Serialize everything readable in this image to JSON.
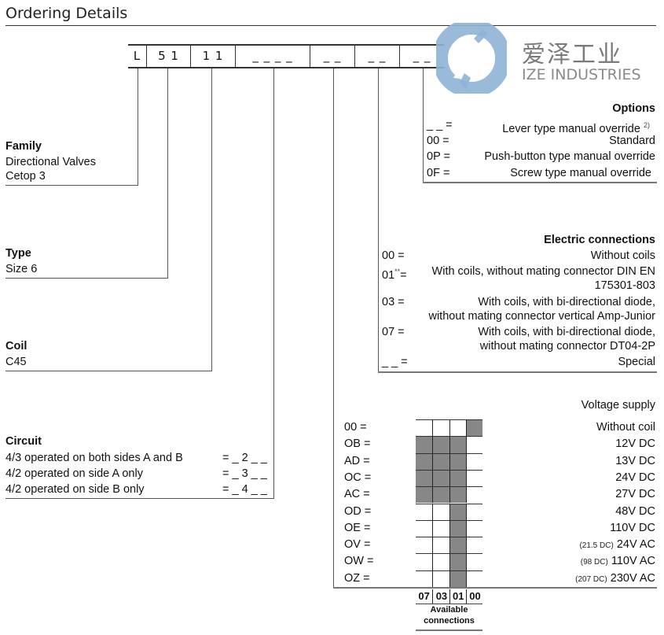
{
  "title": "Ordering Details",
  "code_boxes": [
    "L",
    "5 1",
    "1 1",
    "_ _ _ _",
    "_ _",
    "_ _",
    "_ _"
  ],
  "family": {
    "heading": "Family",
    "lines": [
      "Directional Valves",
      "Cetop 3"
    ]
  },
  "type": {
    "heading": "Type",
    "lines": [
      "Size 6"
    ]
  },
  "coil": {
    "heading": "Coil",
    "lines": [
      "C45"
    ]
  },
  "circuit": {
    "heading": "Circuit",
    "rows": [
      {
        "label": "4/3 operated on both sides A and B",
        "code": "= _ 2 _ _"
      },
      {
        "label": "4/2 operated on side A only",
        "code": "= _ 3 _ _"
      },
      {
        "label": "4/2 operated on side B only",
        "code": "= _ 4 _ _"
      }
    ]
  },
  "options": {
    "heading": "Options",
    "rows": [
      {
        "code": "_ _ =",
        "label": "Lever type manual override",
        "footnote": "2)"
      },
      {
        "code": "00 =",
        "label": "Standard"
      },
      {
        "code": "0P =",
        "label": "Push-button type manual override"
      },
      {
        "code": "0F =",
        "label": "Screw type manual override"
      }
    ]
  },
  "electric_connections": {
    "heading": "Electric connections",
    "rows": [
      {
        "code": "00  =",
        "lines": [
          "Without coils"
        ]
      },
      {
        "code": "01",
        "code_sup": "**",
        "code_suffix": "=",
        "lines": [
          "With coils, without mating connector DIN EN",
          "175301-803"
        ]
      },
      {
        "code": "03 =",
        "lines": [
          "With coils, with bi-directional diode,",
          "without mating connector vertical Amp-Junior"
        ]
      },
      {
        "code": "07 =",
        "lines": [
          "With coils, with bi-directional diode,",
          "without mating connector DT04-2P"
        ]
      },
      {
        "code": "_ _  =",
        "lines": [
          "Special"
        ]
      }
    ]
  },
  "voltage_supply": {
    "heading": "Voltage supply",
    "fill_color": "#878787",
    "columns": [
      "07",
      "03",
      "01",
      "00"
    ],
    "footer": [
      "Available",
      "connections"
    ],
    "rows": [
      {
        "code": "00 =",
        "note": "",
        "label": "Without coil",
        "available": [
          false,
          false,
          false,
          true
        ]
      },
      {
        "code": "OB =",
        "note": "",
        "label": "12V DC",
        "available": [
          true,
          true,
          true,
          false
        ]
      },
      {
        "code": "AD =",
        "note": "",
        "label": "13V DC",
        "available": [
          true,
          true,
          true,
          false
        ]
      },
      {
        "code": "OC =",
        "note": "",
        "label": "24V DC",
        "available": [
          true,
          true,
          true,
          false
        ]
      },
      {
        "code": "AC =",
        "note": "",
        "label": "27V DC",
        "available": [
          true,
          true,
          true,
          false
        ]
      },
      {
        "code": "OD =",
        "note": "",
        "label": "48V DC",
        "available": [
          false,
          false,
          true,
          false
        ]
      },
      {
        "code": "OE =",
        "note": "",
        "label": "110V DC",
        "available": [
          false,
          false,
          true,
          false
        ]
      },
      {
        "code": "OV =",
        "note": "(21.5 DC)",
        "label": "24V AC",
        "available": [
          false,
          false,
          true,
          false
        ]
      },
      {
        "code": "OW =",
        "note": "(98 DC)",
        "label": "110V AC",
        "available": [
          false,
          false,
          true,
          false
        ]
      },
      {
        "code": "OZ =",
        "note": "(207 DC)",
        "label": "230V AC",
        "available": [
          false,
          false,
          true,
          false
        ]
      }
    ]
  },
  "watermark": {
    "icon": "ize-logo-icon",
    "color": "#8fb2d6",
    "chinese": "爱泽工业",
    "english": "IZE INDUSTRIES"
  }
}
